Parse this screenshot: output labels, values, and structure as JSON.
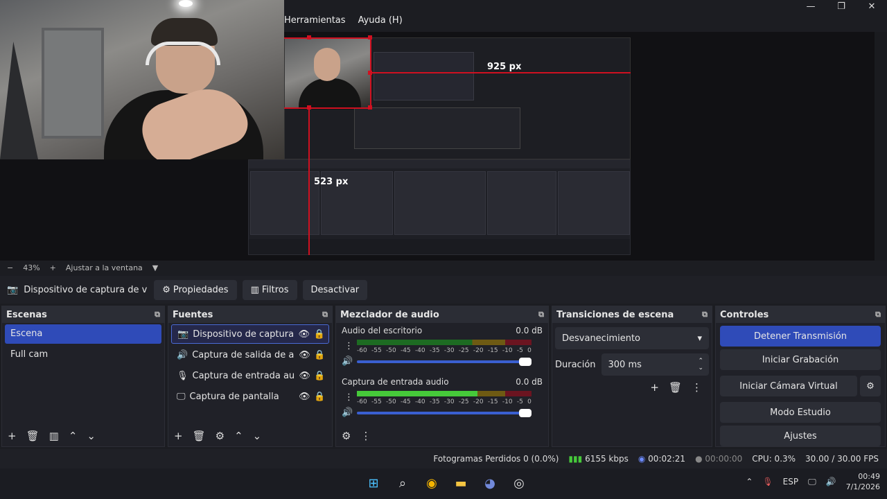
{
  "menu": {
    "tools": "Herramientas",
    "help": "Ayuda (H)"
  },
  "window": {
    "minimize": "—",
    "maximize": "❐",
    "close": "✕"
  },
  "preview": {
    "measure_h": "925 px",
    "measure_v": "523 px"
  },
  "zoom": {
    "minus": "−",
    "level": "43%",
    "plus": "+",
    "fit": "Ajustar a la ventana",
    "dropdown": "▼"
  },
  "source_toolbar": {
    "name": "Dispositivo de captura de v",
    "properties": "Propiedades",
    "filters": "Filtros",
    "deactivate": "Desactivar"
  },
  "scenes": {
    "title": "Escenas",
    "items": [
      {
        "label": "Escena"
      },
      {
        "label": "Full cam"
      }
    ]
  },
  "sources": {
    "title": "Fuentes",
    "items": [
      {
        "label": "Dispositivo de captura de v",
        "icon": "camera-icon"
      },
      {
        "label": "Captura de salida de audio",
        "icon": "speaker-icon"
      },
      {
        "label": "Captura de entrada audio",
        "icon": "microphone-icon"
      },
      {
        "label": "Captura de pantalla",
        "icon": "monitor-icon"
      }
    ]
  },
  "mixer": {
    "title": "Mezclador de audio",
    "channels": [
      {
        "name": "Audio del escritorio",
        "db": "0.0 dB",
        "level": 0.0
      },
      {
        "name": "Captura de entrada audio",
        "db": "0.0 dB",
        "level": 0.69
      }
    ],
    "ticks": [
      "-60",
      "-55",
      "-50",
      "-45",
      "-40",
      "-35",
      "-30",
      "-25",
      "-20",
      "-15",
      "-10",
      "-5",
      "0"
    ]
  },
  "transitions": {
    "title": "Transiciones de escena",
    "selected": "Desvanecimiento",
    "duration_label": "Duración",
    "duration_value": "300 ms"
  },
  "controls": {
    "title": "Controles",
    "stop_stream": "Detener Transmisión",
    "start_recording": "Iniciar Grabación",
    "virtual_cam": "Iniciar Cámara Virtual",
    "studio_mode": "Modo Estudio",
    "settings": "Ajustes"
  },
  "status": {
    "dropped": "Fotogramas Perdidos 0 (0.0%)",
    "bitrate": "6155 kbps",
    "stream_time": "00:02:21",
    "rec_time": "00:00:00",
    "cpu": "CPU: 0.3%",
    "fps": "30.00 / 30.00 FPS"
  },
  "taskbar": {
    "lang": "ESP",
    "time": "00:49",
    "date": "7/1/2026"
  },
  "colors": {
    "accent": "#2f4bb8",
    "measure": "#d01020",
    "meter_green": "#46c93a"
  }
}
